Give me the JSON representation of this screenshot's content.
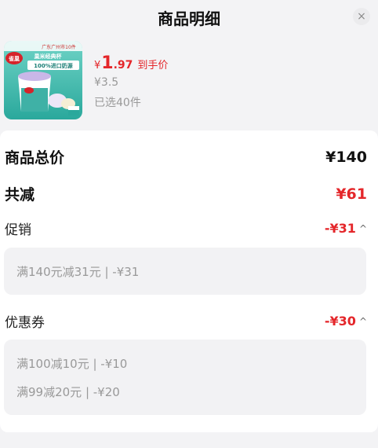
{
  "header": {
    "title": "商品明细",
    "close_icon": "×"
  },
  "product": {
    "currency": "¥",
    "price_int": "1",
    "price_dec": ".97",
    "price_tag": "到手价",
    "original_price": "¥3.5",
    "selected": "已选40件",
    "image_text": [
      "广东广州市10件",
      "雀巢",
      "巢米经典杯",
      "100%进口奶源"
    ]
  },
  "summary": {
    "total_label": "商品总价",
    "total_value": "¥140",
    "discount_label": "共减",
    "discount_value": "¥61"
  },
  "promotion": {
    "label": "促销",
    "value": "-¥31",
    "chevron": "^",
    "items": [
      "满140元减31元 | -¥31"
    ]
  },
  "coupon": {
    "label": "优惠券",
    "value": "-¥30",
    "chevron": "^",
    "items": [
      "满100减10元 | -¥10",
      "满99减20元 | -¥20"
    ]
  },
  "colors": {
    "accent": "#e4262a",
    "background": "#f3f3f5",
    "card": "#ffffff"
  }
}
